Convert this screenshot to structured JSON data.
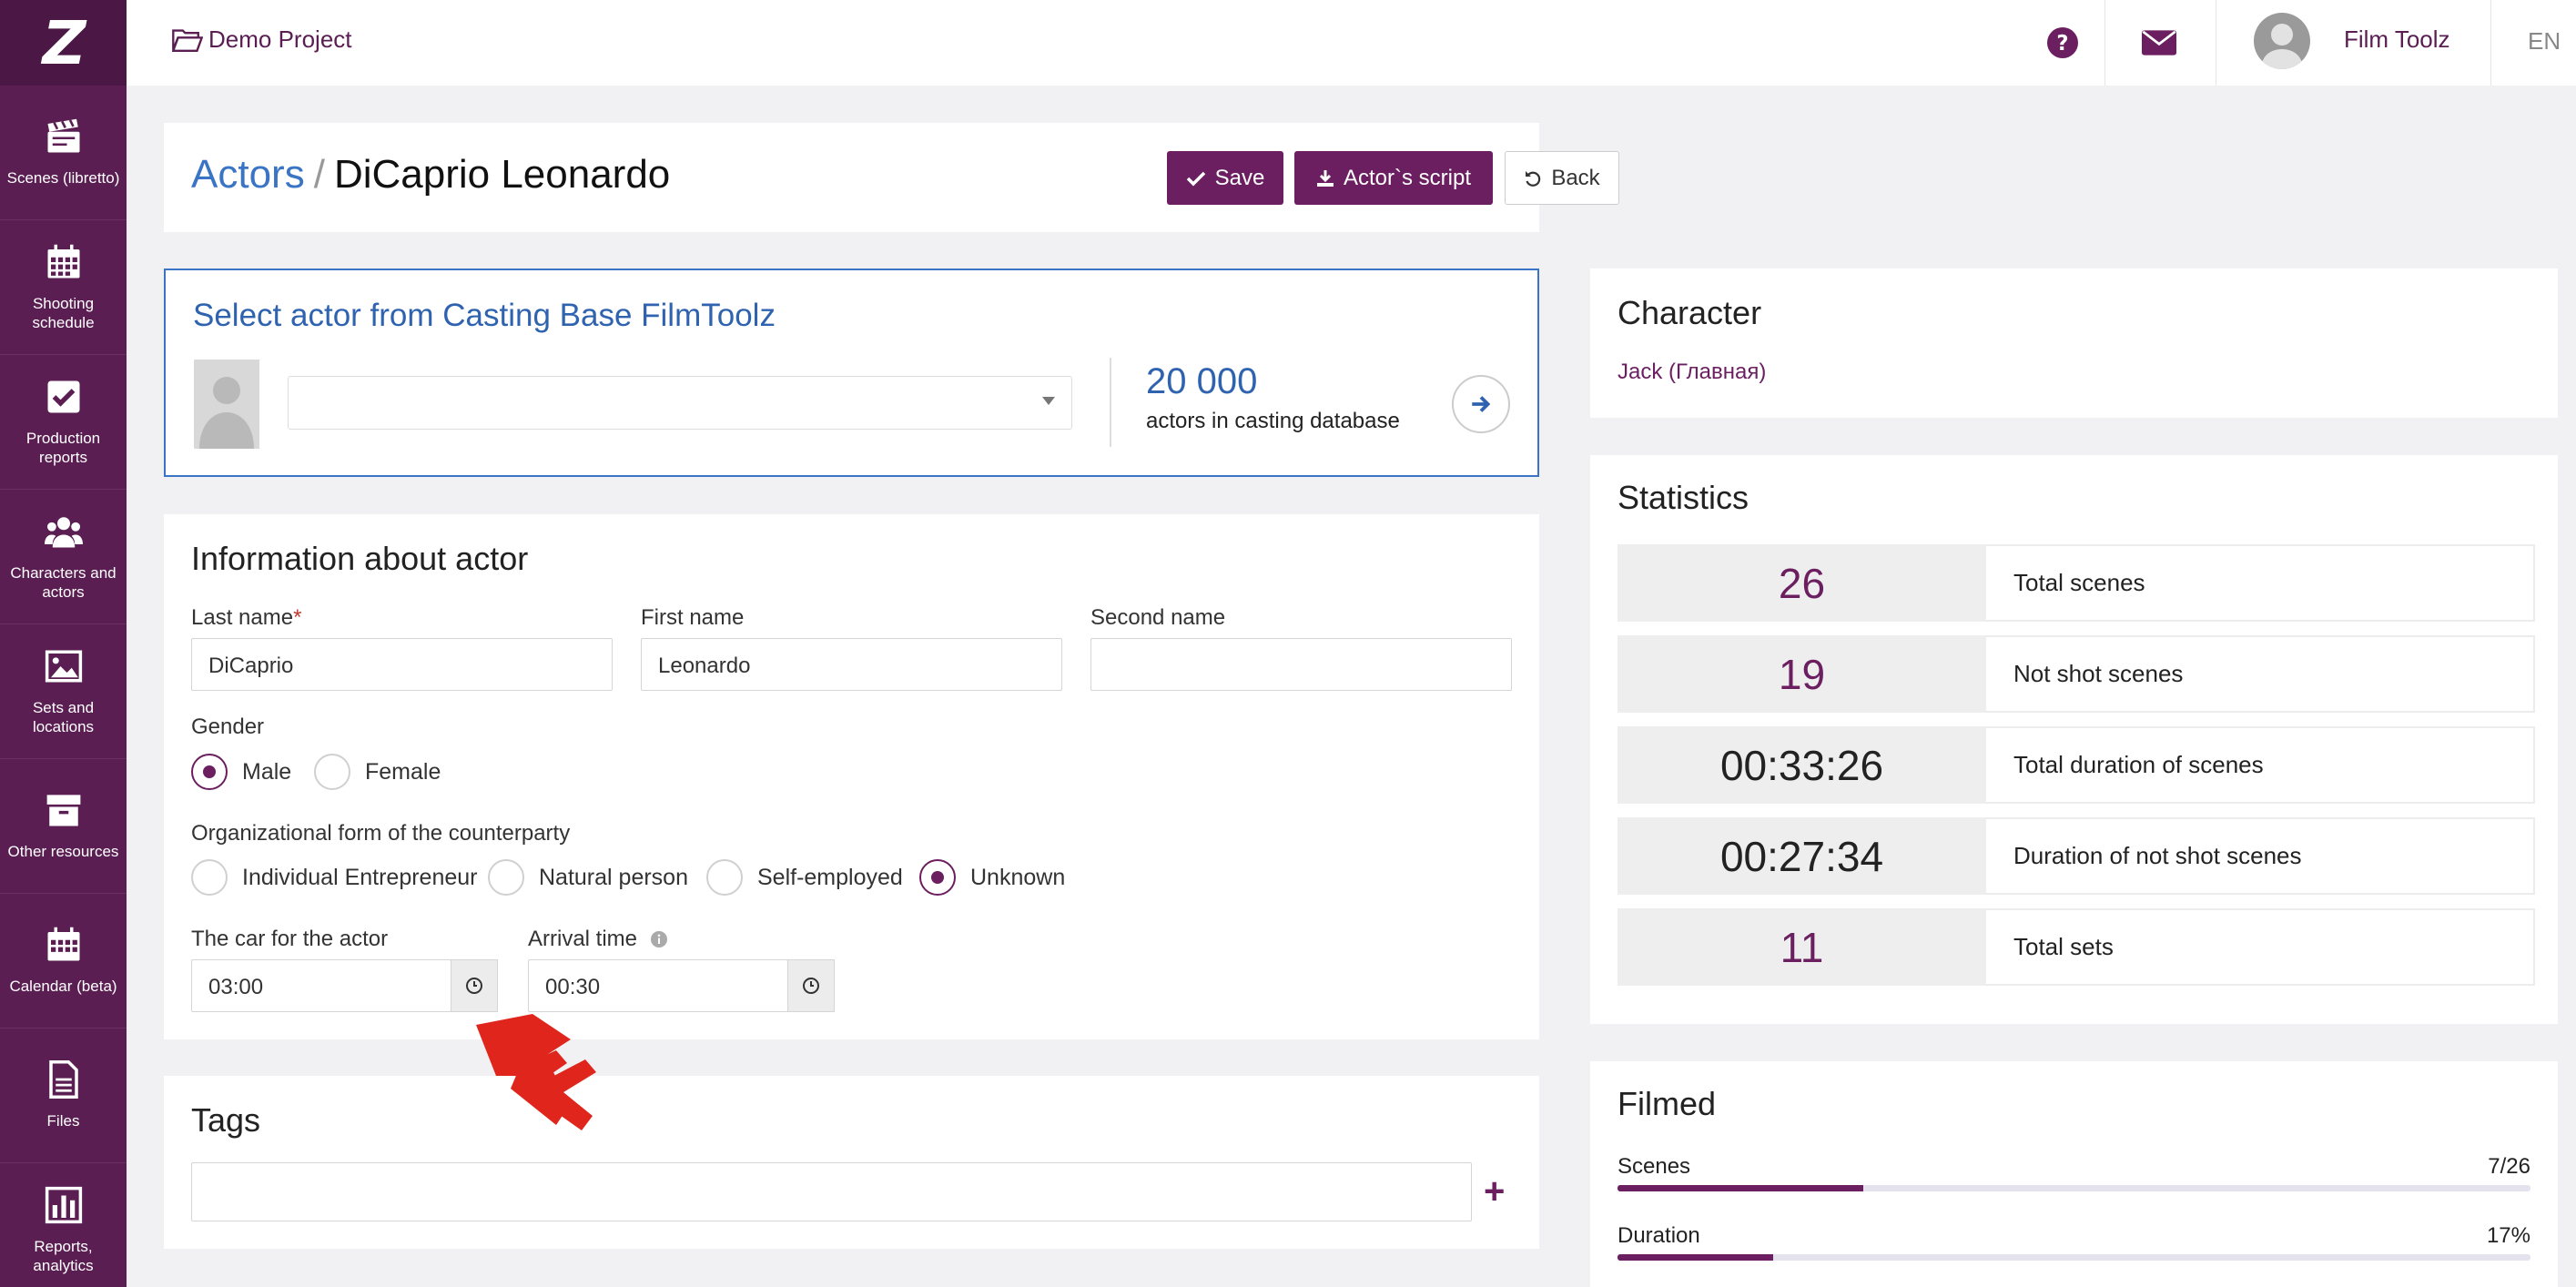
{
  "sidebar": {
    "logo": "Z",
    "items": [
      {
        "label": "Scenes (libretto)",
        "icon": "clapperboard-icon"
      },
      {
        "label": "Shooting schedule",
        "icon": "calendar-grid-icon"
      },
      {
        "label": "Production reports",
        "icon": "checkbox-icon"
      },
      {
        "label": "Characters and actors",
        "icon": "users-icon"
      },
      {
        "label": "Sets and locations",
        "icon": "image-icon"
      },
      {
        "label": "Other resources",
        "icon": "archive-box-icon"
      },
      {
        "label": "Calendar (beta)",
        "icon": "calendar-icon"
      },
      {
        "label": "Files",
        "icon": "file-icon"
      },
      {
        "label": "Reports, analytics",
        "icon": "bar-chart-icon"
      }
    ]
  },
  "topbar": {
    "project": "Demo Project",
    "user": "Film Toolz",
    "lang": "EN"
  },
  "header": {
    "crumb_link": "Actors",
    "crumb_sep": "/",
    "crumb_current": "DiCaprio Leonardo",
    "save": "Save",
    "script": "Actor`s script",
    "back": "Back"
  },
  "casting": {
    "title": "Select actor from Casting Base FilmToolz",
    "count": "20 000",
    "count_label": "actors in casting database"
  },
  "info": {
    "title": "Information about actor",
    "last_name_label": "Last name",
    "last_name_required": "*",
    "last_name": "DiCaprio",
    "first_name_label": "First name",
    "first_name": "Leonardo",
    "second_name_label": "Second name",
    "second_name": "",
    "gender_label": "Gender",
    "gender_options": [
      "Male",
      "Female"
    ],
    "gender_selected": "Male",
    "org_label": "Organizational form of the counterparty",
    "org_options": [
      "Individual Entrepreneur",
      "Natural person",
      "Self-employed",
      "Unknown"
    ],
    "org_selected": "Unknown",
    "car_label": "The car for the actor",
    "car_time": "03:00",
    "arrival_label": "Arrival time",
    "arrival_time": "00:30"
  },
  "tags": {
    "title": "Tags",
    "add": "+"
  },
  "character": {
    "title": "Character",
    "name": "Jack (Главная)"
  },
  "statistics": {
    "title": "Statistics",
    "rows": [
      {
        "value": "26",
        "label": "Total scenes"
      },
      {
        "value": "19",
        "label": "Not shot scenes"
      },
      {
        "value": "00:33:26",
        "label": "Total duration of scenes"
      },
      {
        "value": "00:27:34",
        "label": "Duration of not shot scenes"
      },
      {
        "value": "11",
        "label": "Total sets"
      }
    ],
    "value_colors": [
      "#6b1f60",
      "#6b1f60",
      "#222222",
      "#222222",
      "#6b1f60"
    ]
  },
  "filmed": {
    "title": "Filmed",
    "scenes_label": "Scenes",
    "scenes_value": "7/26",
    "scenes_fraction": 0.269,
    "duration_label": "Duration",
    "duration_value": "17%",
    "duration_fraction": 0.17
  },
  "colors": {
    "brand": "#5a1e52",
    "accent": "#6b1f60",
    "link": "#3a74c4",
    "overlay_arrow": "#e0261c"
  }
}
